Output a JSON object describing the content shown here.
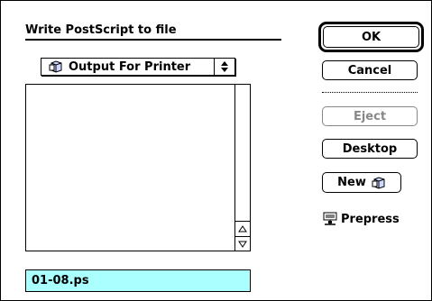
{
  "dialog": {
    "prompt": "Write PostScript to file",
    "folder_popup": {
      "label": "Output For Printer",
      "icon": "folder-icon"
    },
    "file_list": {
      "items": []
    },
    "filename": "01-08.ps",
    "colors": {
      "filename_highlight": "#aaffff",
      "disabled_text": "#888888"
    }
  },
  "buttons": {
    "ok": "OK",
    "cancel": "Cancel",
    "eject": "Eject",
    "desktop": "Desktop",
    "new": "New"
  },
  "volume": {
    "label": "Prepress",
    "icon": "network-volume-icon"
  }
}
